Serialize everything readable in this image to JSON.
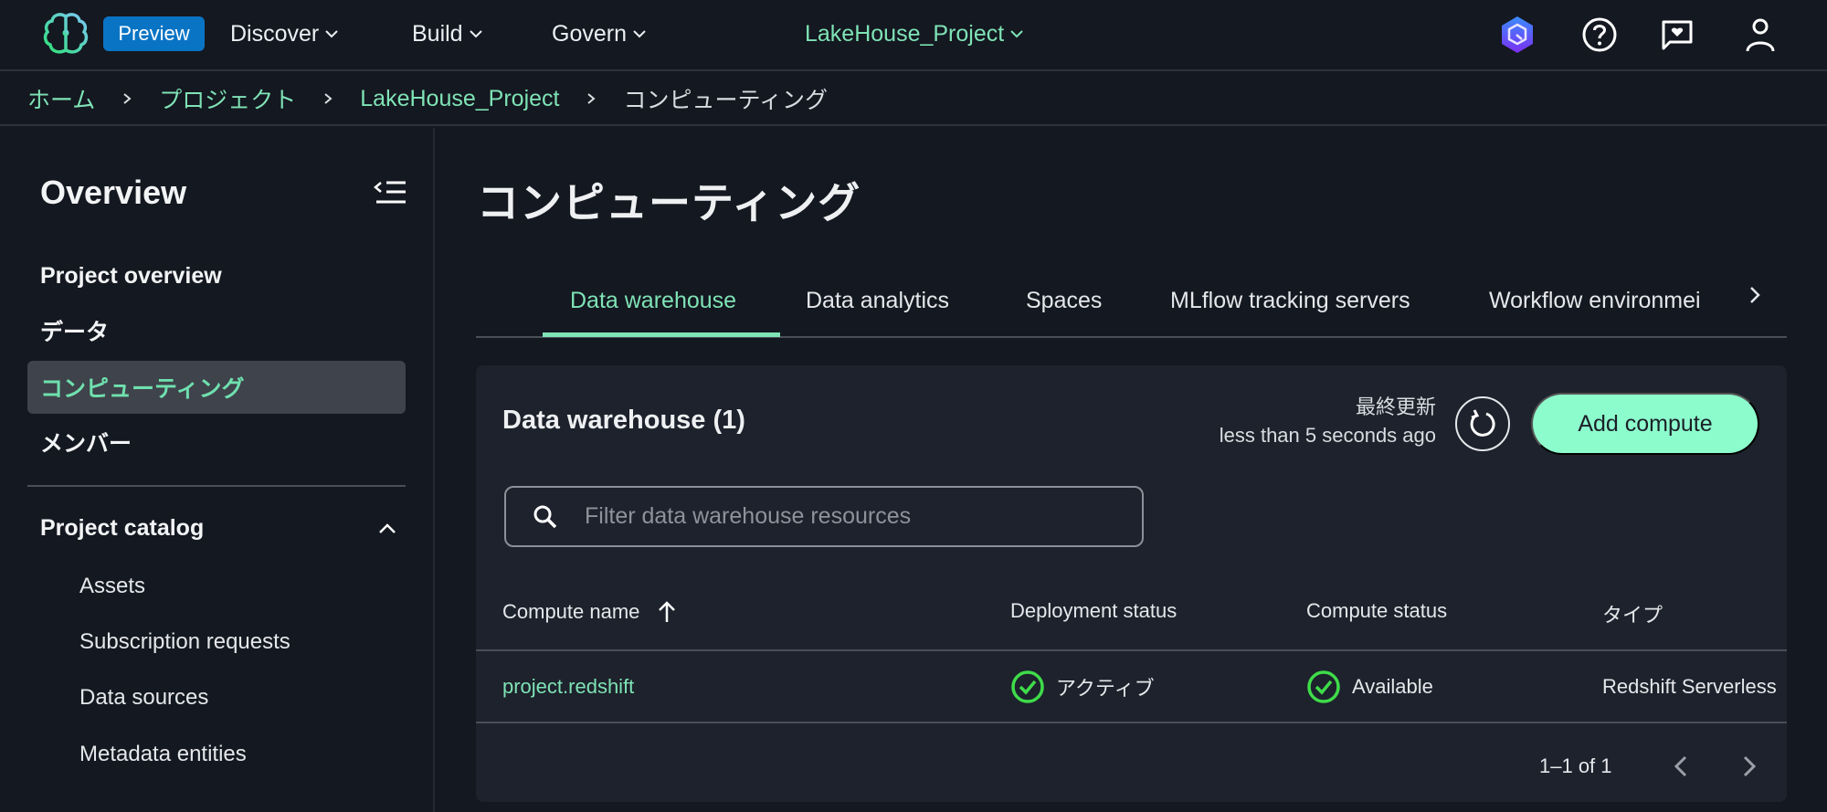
{
  "topnav": {
    "logo_icon": "brain-logo-icon",
    "preview_badge": "Preview",
    "menus": [
      {
        "label": "Discover"
      },
      {
        "label": "Build"
      },
      {
        "label": "Govern"
      }
    ],
    "project_selector": "LakeHouse_Project",
    "icons": [
      "amazon-q-icon",
      "help-icon",
      "feedback-icon",
      "user-icon"
    ]
  },
  "breadcrumb": [
    {
      "label": "ホーム"
    },
    {
      "label": "プロジェクト"
    },
    {
      "label": "LakeHouse_Project"
    },
    {
      "label": "コンピューティング"
    }
  ],
  "sidebar": {
    "title": "Overview",
    "items": [
      {
        "label": "Project overview"
      },
      {
        "label": "データ"
      },
      {
        "label": "コンピューティング",
        "active": true
      },
      {
        "label": "メンバー"
      }
    ],
    "catalog": {
      "label": "Project catalog",
      "expanded": true,
      "items": [
        {
          "label": "Assets"
        },
        {
          "label": "Subscription requests"
        },
        {
          "label": "Data sources"
        },
        {
          "label": "Metadata entities"
        }
      ]
    }
  },
  "main": {
    "title": "コンピューティング",
    "tabs": [
      {
        "label": "Data warehouse",
        "active": true
      },
      {
        "label": "Data analytics"
      },
      {
        "label": "Spaces"
      },
      {
        "label": "MLflow tracking servers"
      },
      {
        "label": "Workflow environmei"
      }
    ],
    "panel": {
      "title": "Data warehouse (1)",
      "last_updated_label": "最終更新",
      "last_updated_value": "less than 5 seconds ago",
      "add_button": "Add compute",
      "filter_placeholder": "Filter data warehouse resources",
      "filter_value": "",
      "columns": [
        "Compute name",
        "Deployment status",
        "Compute status",
        "タイプ"
      ],
      "sort_column": "Compute name",
      "sort_direction": "ascending",
      "rows": [
        {
          "name": "project.redshift",
          "deployment_status": "アクティブ",
          "compute_status": "Available",
          "type": "Redshift Serverless"
        }
      ],
      "pagination": "1–1 of 1"
    }
  },
  "colors": {
    "accent": "#7fe3b6",
    "primary_button": "#8dfccd",
    "preview_badge": "#0a74c4",
    "status_ok": "#3fdc4a",
    "background": "#141820",
    "panel": "#1d222c"
  }
}
